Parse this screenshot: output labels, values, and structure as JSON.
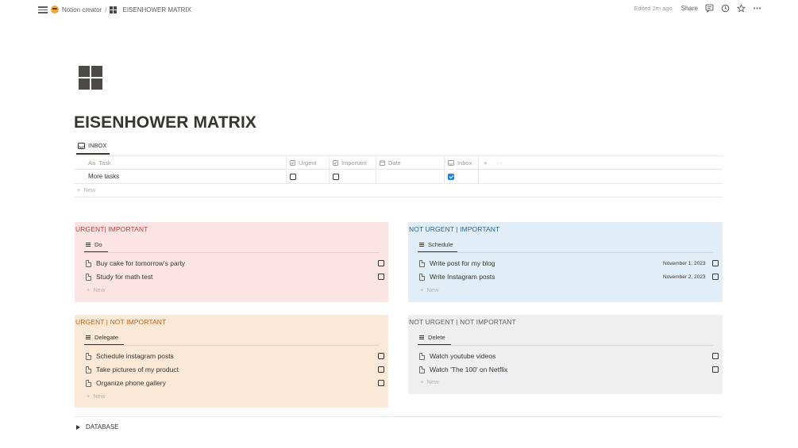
{
  "topbar": {
    "breadcrumb": [
      {
        "label": "Notion creator",
        "icon": "emoji-face-icon"
      },
      {
        "label": "EISENHOWER MATRIX",
        "icon": "grid-icon"
      }
    ],
    "separator": "/",
    "edited": "Edited 2m ago",
    "share_label": "Share",
    "icons": [
      "comment-icon",
      "clock-icon",
      "star-icon",
      "more-icon"
    ]
  },
  "page": {
    "title": "EISENHOWER MATRIX",
    "icon": "grid-icon"
  },
  "inbox_db": {
    "view_label": "INBOX",
    "columns": [
      "Task",
      "Urgent",
      "Important",
      "Date",
      "Inbox"
    ],
    "column_prefixes": {
      "task": "Aa"
    },
    "rows": [
      {
        "task": "More tasks",
        "urgent": false,
        "important": false,
        "date": "",
        "inbox": true
      }
    ],
    "new_label": "New",
    "add_symbol": "+",
    "more_symbol": "···"
  },
  "quadrants": [
    {
      "title": "URGENT| IMPORTANT",
      "view_label": "Do",
      "bg": "#fde4e4",
      "title_color": "#c4403b",
      "items": [
        {
          "label": "Buy cake for tomorrow's party",
          "date": "",
          "checked": false
        },
        {
          "label": "Study for math test",
          "date": "",
          "checked": false
        }
      ],
      "new_label": "New"
    },
    {
      "title": "NOT URGENT | IMPORTANT",
      "view_label": "Schedule",
      "bg": "#e2eef7",
      "title_color": "#2f6690",
      "items": [
        {
          "label": "Write post for my blog",
          "date": "November 1, 2023",
          "checked": false
        },
        {
          "label": "Write Instagram posts",
          "date": "November 2, 2023",
          "checked": false
        }
      ],
      "new_label": "New"
    },
    {
      "title": "URGENT | NOT IMPORTANT",
      "view_label": "Delegate",
      "bg": "#fbe8d7",
      "title_color": "#c4631a",
      "items": [
        {
          "label": "Schedule instagram posts",
          "date": "",
          "checked": false
        },
        {
          "label": "Take pictures of my product",
          "date": "",
          "checked": false
        },
        {
          "label": "Organize phone gallery",
          "date": "",
          "checked": false
        }
      ],
      "new_label": "New"
    },
    {
      "title": "NOT URGENT | NOT IMPORTANT",
      "view_label": "Delete",
      "bg": "#efefef",
      "title_color": "#5f5e5b",
      "items": [
        {
          "label": "Watch youtube videos",
          "date": "",
          "checked": false
        },
        {
          "label": "Watch 'The 100' on Netflix",
          "date": "",
          "checked": false
        }
      ],
      "new_label": "New"
    }
  ],
  "toggle": {
    "label": "DATABASE"
  },
  "colors": {
    "text": "#37352f",
    "muted": "#9b9a97",
    "accent": "#2383e2"
  }
}
